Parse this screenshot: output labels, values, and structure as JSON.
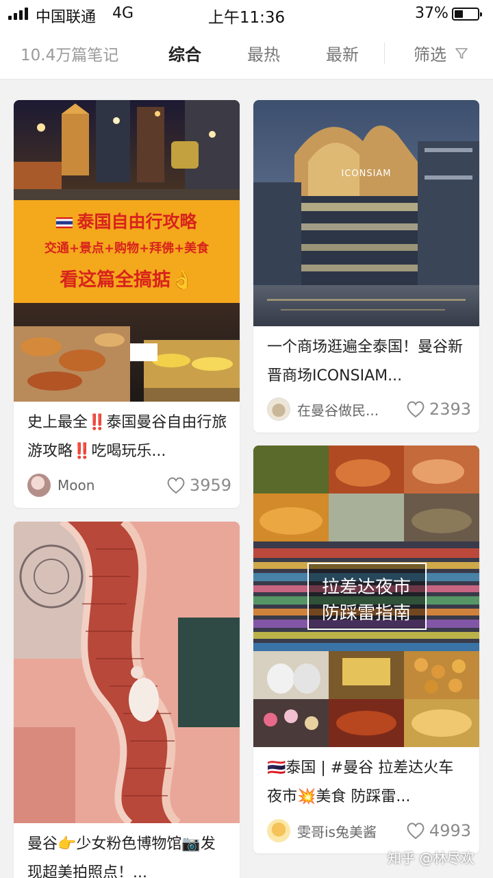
{
  "status_bar": {
    "carrier": "中国联通",
    "network": "4G",
    "time": "上午11:36",
    "battery": "37%",
    "battery_level": 0.37
  },
  "tabs": {
    "count": "10.4万篇笔记",
    "items": [
      "综合",
      "最热",
      "最新"
    ],
    "active": "综合",
    "filter": "筛选"
  },
  "cards": [
    {
      "overlay_line1": "泰国自由行攻略",
      "overlay_line2": "交通+景点+购物+拜佛+美食",
      "overlay_line3": "看这篇全搞掂",
      "overlay_emoji": "👌",
      "title": "史上最全‼️泰国曼谷自由行旅游攻略‼️吃喝玩乐...",
      "author": "Moon",
      "likes": "3959"
    },
    {
      "sign": "ICONSIAM",
      "title": "一个商场逛遍全泰国！曼谷新晋商场ICONSIAM...",
      "author": "在曼谷做民...",
      "likes": "2393"
    },
    {
      "overlay_line1": "拉差达夜市",
      "overlay_line2": "防踩雷指南",
      "title": "🇹🇭泰国 | #曼谷 拉差达火车夜市💥美食 防踩雷...",
      "author": "雯哥is兔美酱",
      "likes": "4993"
    },
    {
      "title": "曼谷👉少女粉色博物馆📷发现超美拍照点！..."
    }
  ],
  "watermark": "知乎 @林尽欢",
  "colors": {
    "banner_orange": "#f4a81c",
    "banner_red": "#d8231c",
    "pink_staircase": "#e9a79a"
  }
}
